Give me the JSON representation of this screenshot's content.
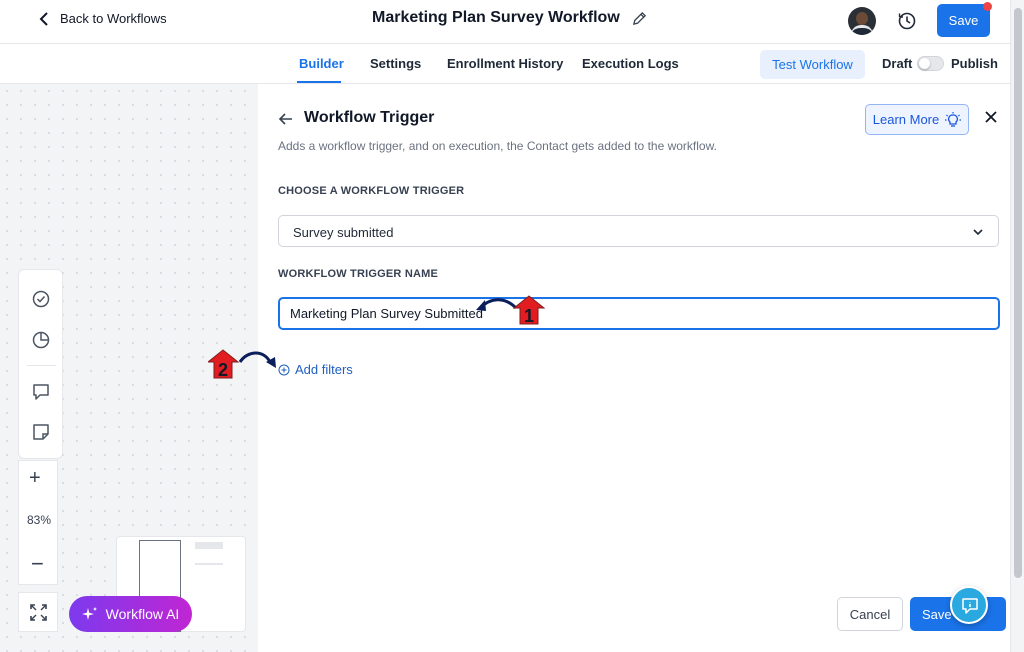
{
  "header": {
    "back_label": "Back to Workflows",
    "workflow_title": "Marketing Plan Survey Workflow",
    "save_label": "Save"
  },
  "tabs": [
    {
      "label": "Builder",
      "active": true
    },
    {
      "label": "Settings",
      "active": false
    },
    {
      "label": "Enrollment History",
      "active": false
    },
    {
      "label": "Execution Logs",
      "active": false
    }
  ],
  "tab_actions": {
    "test_label": "Test Workflow",
    "draft_label": "Draft",
    "publish_label": "Publish",
    "publish_on": false
  },
  "canvas": {
    "zoom_level": "83%",
    "workflow_ai_label": "Workflow AI"
  },
  "panel": {
    "title": "Workflow Trigger",
    "description": "Adds a workflow trigger, and on execution, the Contact gets added to the workflow.",
    "learn_more_label": "Learn More",
    "choose_label": "CHOOSE A WORKFLOW TRIGGER",
    "trigger_selected": "Survey submitted",
    "name_label": "WORKFLOW TRIGGER NAME",
    "name_value": "Marketing Plan Survey Submitted",
    "add_filters_label": "Add filters",
    "cancel_label": "Cancel",
    "save_trigger_label": "Save"
  },
  "annotations": [
    "1",
    "2"
  ],
  "colors": {
    "primary": "#1a73e8",
    "annotation_red": "#e11d21",
    "annotation_arrow": "#0b1f5c"
  },
  "icons": [
    "chevron-left-icon",
    "pencil-icon",
    "history-icon",
    "check-circle-icon",
    "pie-chart-icon",
    "comment-icon",
    "sticky-note-icon",
    "expand-icon",
    "sparkle-icon",
    "arrow-left-icon",
    "lightbulb-icon",
    "close-icon",
    "chevron-down-icon",
    "plus-circle-icon",
    "help-chat-icon"
  ]
}
